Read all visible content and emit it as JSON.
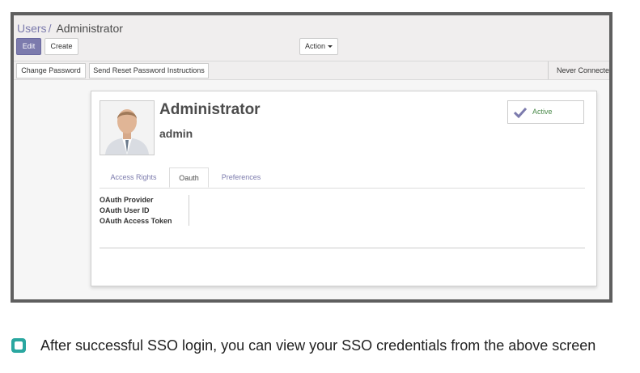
{
  "breadcrumb": {
    "parent": "Users",
    "separator": "/",
    "current": "Administrator"
  },
  "toolbar": {
    "edit_label": "Edit",
    "create_label": "Create",
    "action_label": "Action"
  },
  "statusbar": {
    "change_password_label": "Change Password",
    "reset_password_label": "Send Reset Password Instructions",
    "right_text": "Never Connected"
  },
  "user": {
    "name": "Administrator",
    "login": "admin"
  },
  "active_button": {
    "label": "Active"
  },
  "tabs": [
    {
      "label": "Access Rights"
    },
    {
      "label": "Oauth"
    },
    {
      "label": "Preferences"
    }
  ],
  "oauth_fields": [
    {
      "label": "OAuth Provider"
    },
    {
      "label": "OAuth User ID"
    },
    {
      "label": "OAuth Access Token"
    }
  ],
  "caption": {
    "text": "After successful SSO login, you can view your SSO credentials from the above screen"
  },
  "colors": {
    "primary": "#7c7bad",
    "caption_icon": "#2aa7a0"
  }
}
